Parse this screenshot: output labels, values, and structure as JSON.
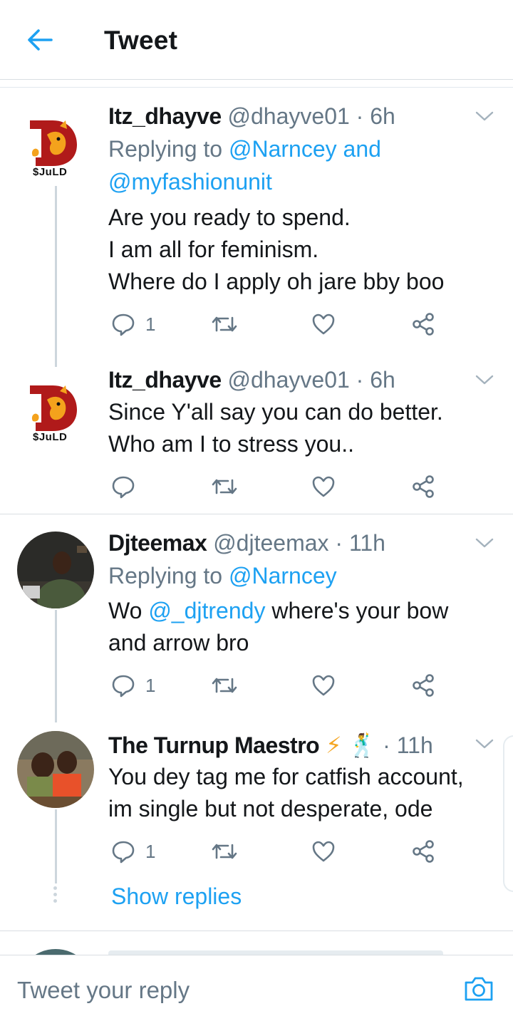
{
  "header": {
    "title": "Tweet"
  },
  "tweets": [
    {
      "name": "Itz_dhayve",
      "handle": "@dhayve01",
      "sep": "·",
      "time": "6h",
      "replying_prefix": "Replying to",
      "replying_links": [
        "@Narncey",
        "and",
        "@myfashionunit"
      ],
      "body": [
        "Are you ready to spend.",
        "I am all for feminism.",
        "Where do I apply oh jare bby boo"
      ],
      "reply_count": "1",
      "avatar_text": "$JuLD"
    },
    {
      "name": "Itz_dhayve",
      "handle": "@dhayve01",
      "sep": "·",
      "time": "6h",
      "body": [
        "Since Y'all say you can do better.",
        "Who am I to stress you.."
      ],
      "reply_count": "",
      "avatar_text": "$JuLD"
    },
    {
      "name": "Djteemax",
      "handle": "@djteemax",
      "sep": "·",
      "time": "11h",
      "replying_prefix": "Replying to",
      "replying_links": [
        "@Narncey"
      ],
      "body_prefix": "Wo",
      "body_mention": "@_djtrendy",
      "body_suffix": "where's your bow",
      "body_line2": "and arrow bro",
      "reply_count": "1"
    },
    {
      "name": "The Turnup Maestro",
      "emoji": "⚡ 🕺",
      "sep": "·",
      "time": "11h",
      "body": [
        "You dey tag me for catfish account,",
        "im single but not desperate, ode"
      ],
      "reply_count": "1"
    }
  ],
  "show_replies": "Show replies",
  "composer": {
    "placeholder": "Tweet your reply"
  },
  "colors": {
    "accent": "#1da1f2",
    "muted": "#657786",
    "text": "#14171a",
    "divider": "#d9dee2"
  },
  "icons": [
    "back-arrow-icon",
    "chevron-down-icon",
    "reply-icon",
    "retweet-icon",
    "like-icon",
    "share-icon",
    "camera-icon"
  ]
}
